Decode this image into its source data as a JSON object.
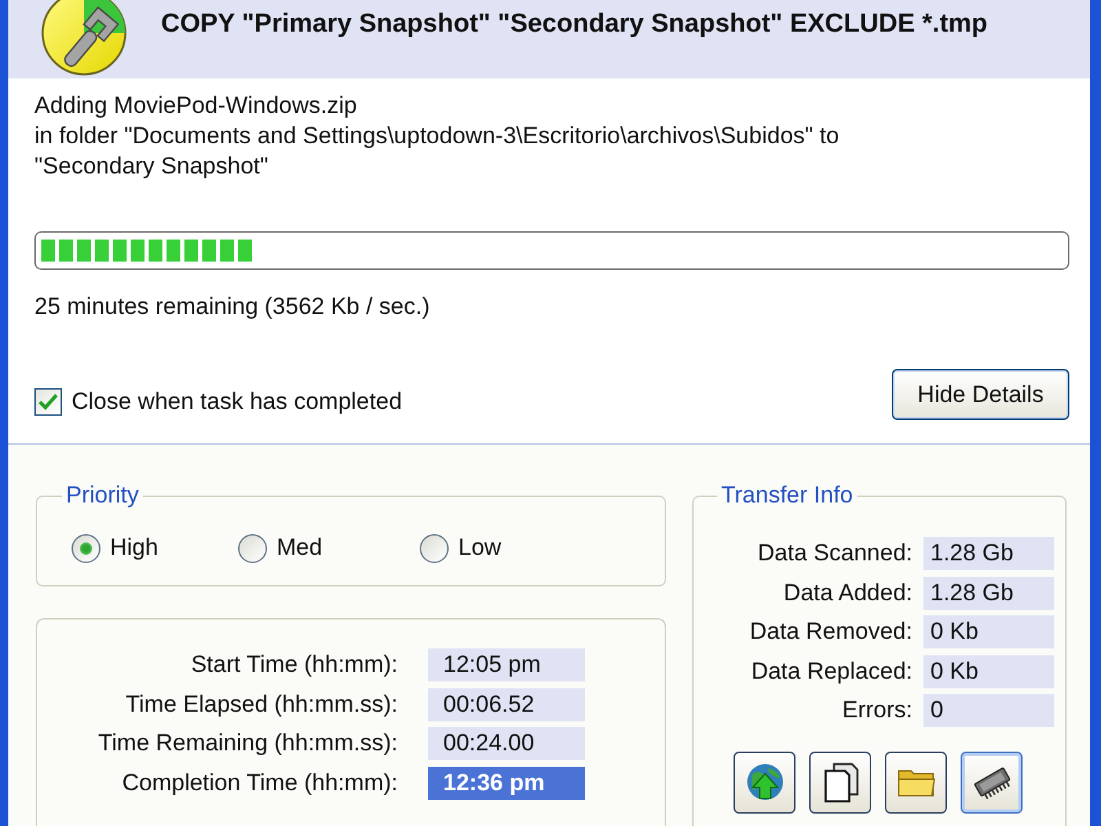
{
  "header": {
    "title": "COPY \"Primary Snapshot\" \"Secondary Snapshot\" EXCLUDE *.tmp"
  },
  "status": {
    "lines": [
      "Adding MoviePod-Windows.zip",
      "in folder \"Documents and Settings\\uptodown-3\\Escritorio\\archivos\\Subidos\" to",
      "\"Secondary Snapshot\""
    ],
    "level": 0.21,
    "remaining": "25 minutes remaining (3562 Kb / sec.)"
  },
  "close_when_done": {
    "label": "Close when task has completed",
    "checked": true
  },
  "details_button": {
    "label": "Hide Details"
  },
  "priority": {
    "title": "Priority",
    "options": [
      {
        "label": "High",
        "selected": true
      },
      {
        "label": "Med",
        "selected": false
      },
      {
        "label": "Low",
        "selected": false
      }
    ]
  },
  "times": [
    {
      "label": "Start Time (hh:mm):",
      "value": "12:05 pm",
      "selected": false
    },
    {
      "label": "Time Elapsed (hh:mm.ss):",
      "value": "00:06.52",
      "selected": false
    },
    {
      "label": "Time Remaining (hh:mm.ss):",
      "value": "00:24.00",
      "selected": false
    },
    {
      "label": "Completion Time (hh:mm):",
      "value": "12:36 pm",
      "selected": true
    }
  ],
  "transfer_info": {
    "title": "Transfer Info",
    "rows": [
      {
        "label": "Data Scanned:",
        "value": "1.28 Gb"
      },
      {
        "label": "Data Added:",
        "value": "1.28 Gb"
      },
      {
        "label": "Data Removed:",
        "value": "0 Kb"
      },
      {
        "label": "Data Replaced:",
        "value": "0 Kb"
      },
      {
        "label": "Errors:",
        "value": "0"
      }
    ]
  },
  "tool_buttons": [
    {
      "kind": "globe",
      "selected": false
    },
    {
      "kind": "pages",
      "selected": false
    },
    {
      "kind": "folder",
      "selected": false
    },
    {
      "kind": "chip",
      "selected": true
    }
  ]
}
